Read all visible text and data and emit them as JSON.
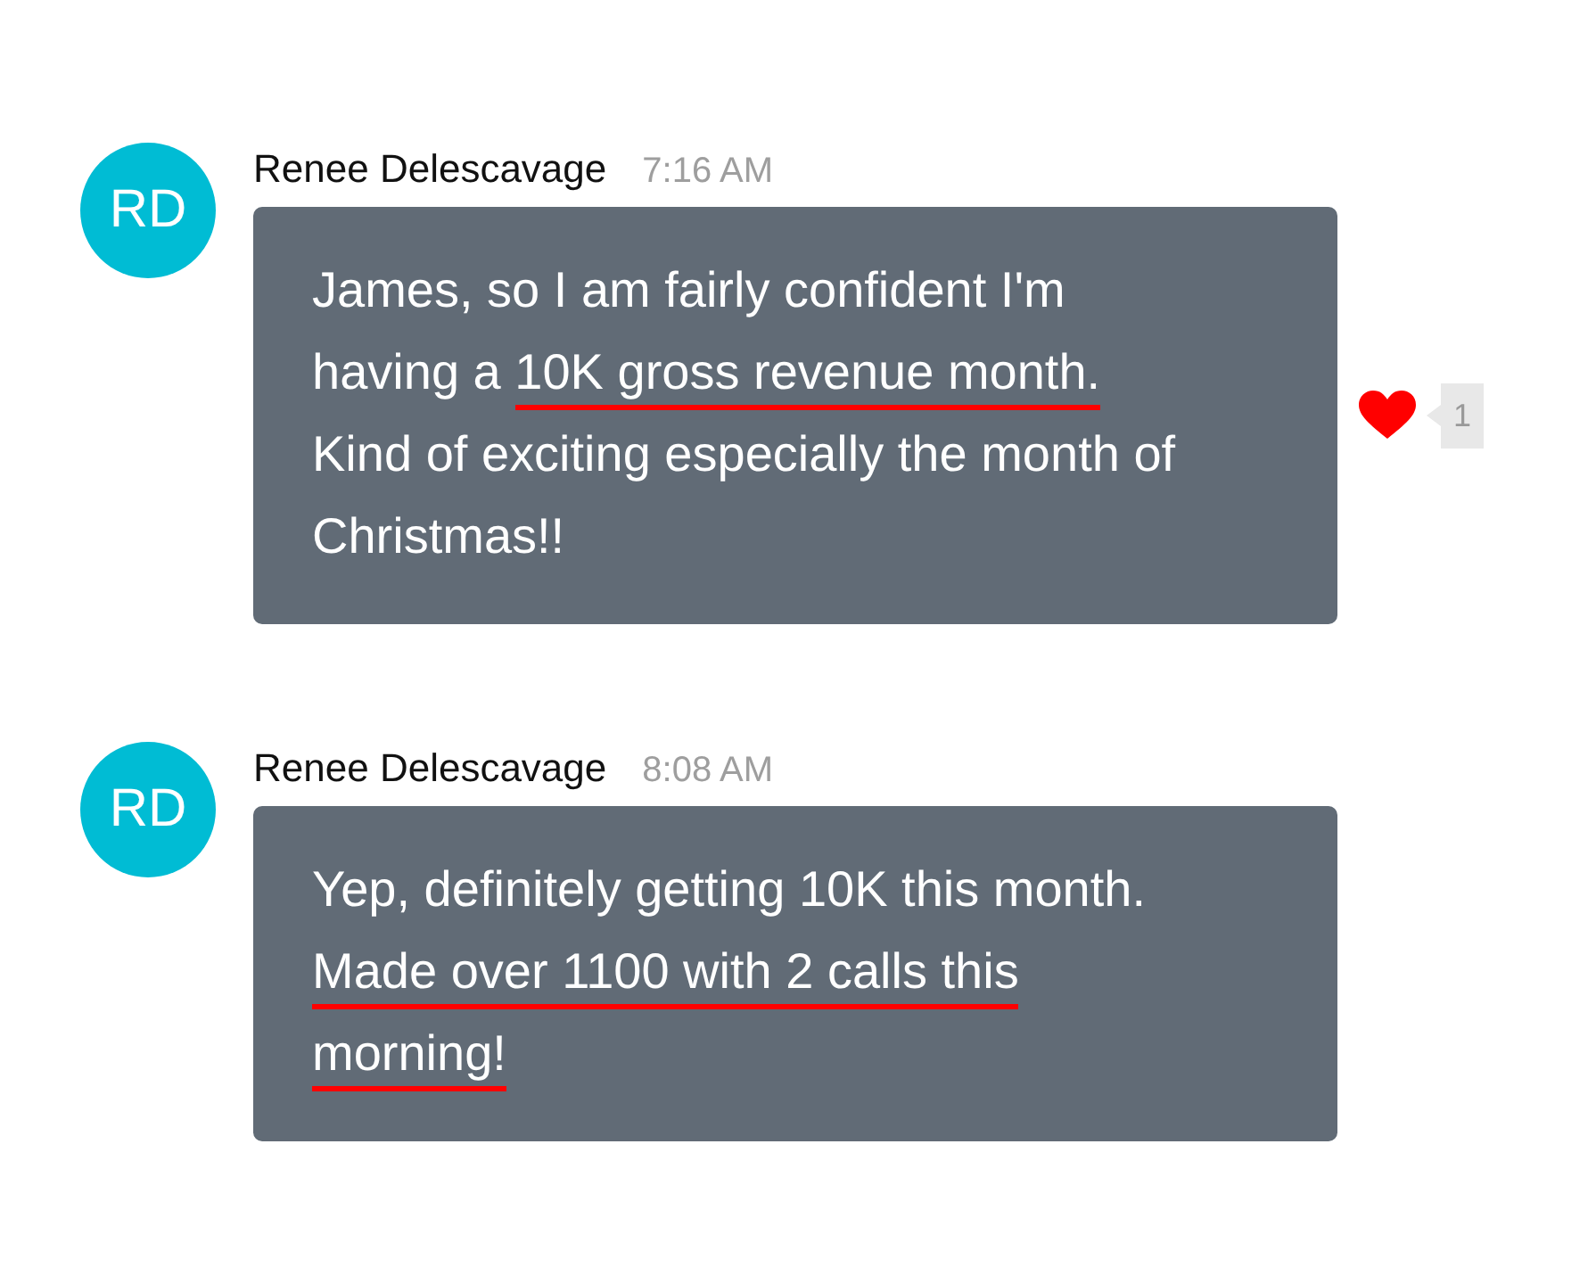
{
  "messages": [
    {
      "avatar": "RD",
      "author": "Renee Delescavage",
      "time": "7:16 AM",
      "segments": [
        {
          "text": "James, so I am fairly confident I'm having a ",
          "underlined": false
        },
        {
          "text": "10K gross revenue month.",
          "underlined": true
        },
        {
          "text": " Kind of exciting especially the month of Christmas!!",
          "underlined": false
        }
      ],
      "reactions": [
        {
          "kind": "heart",
          "count": "1"
        }
      ]
    },
    {
      "avatar": "RD",
      "author": "Renee Delescavage",
      "time": "8:08 AM",
      "segments": [
        {
          "text": "Yep, definitely getting 10K this month. ",
          "underlined": false
        },
        {
          "text": "Made over 1100 with 2 calls this morning!",
          "underlined": true
        }
      ]
    }
  ]
}
